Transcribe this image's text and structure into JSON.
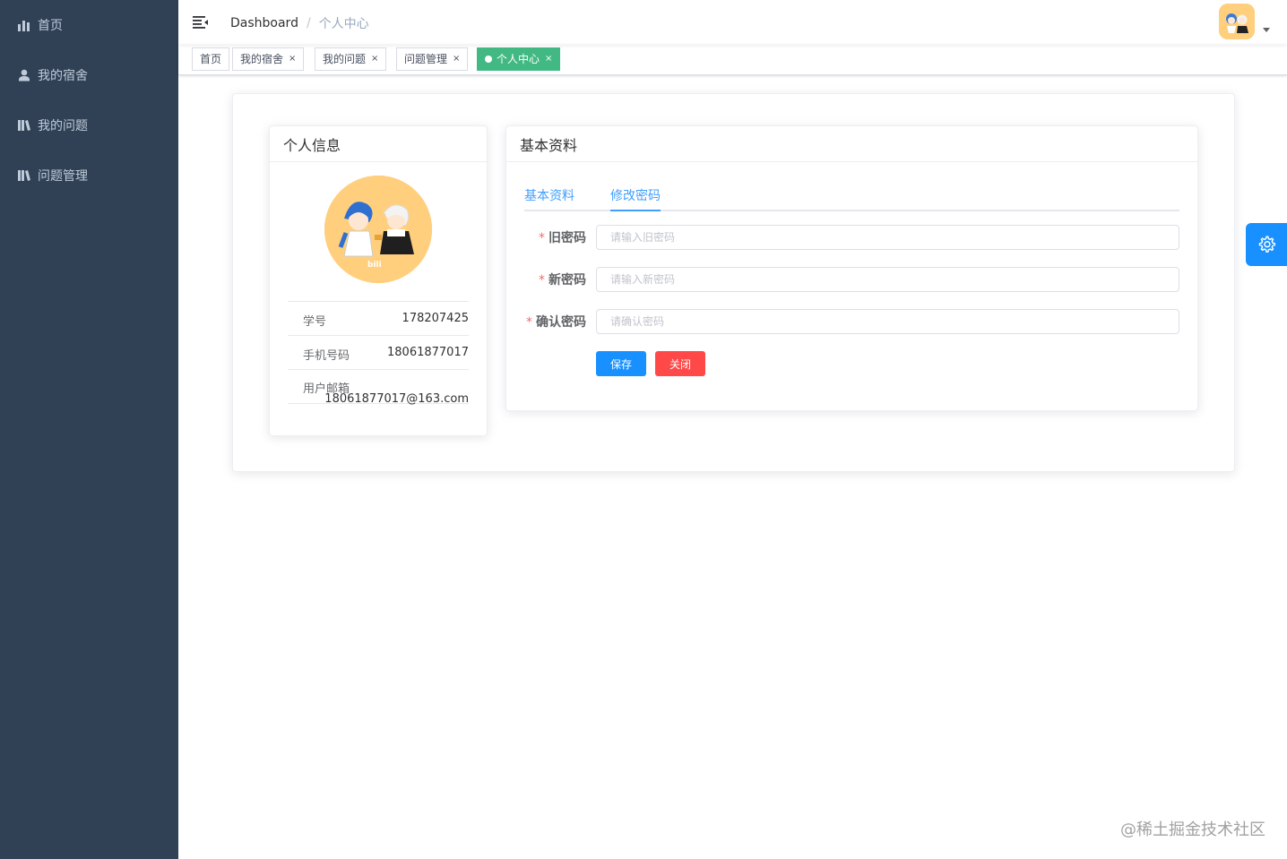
{
  "sidebar": {
    "items": [
      {
        "label": "首页",
        "icon": "chart-icon"
      },
      {
        "label": "我的宿舍",
        "icon": "user-icon"
      },
      {
        "label": "我的问题",
        "icon": "book-icon"
      },
      {
        "label": "问题管理",
        "icon": "book-icon"
      }
    ]
  },
  "navbar": {
    "breadcrumb": {
      "home": "Dashboard",
      "separator": "/",
      "current": "个人中心"
    }
  },
  "tags": [
    {
      "label": "首页",
      "closable": false
    },
    {
      "label": "我的宿舍",
      "closable": true
    },
    {
      "label": "我的问题",
      "closable": true
    },
    {
      "label": "问题管理",
      "closable": true
    },
    {
      "label": "个人中心",
      "closable": true,
      "active": true
    }
  ],
  "tag_close_glyph": "×",
  "profile": {
    "title": "个人信息",
    "student_id_label": "学号",
    "student_id": "178207425",
    "phone_label": "手机号码",
    "phone": "18061877017",
    "email_label": "用户邮箱",
    "email": "18061877017@163.com"
  },
  "basic": {
    "title": "基本资料",
    "tabs": [
      {
        "label": "基本资料",
        "active": false
      },
      {
        "label": "修改密码",
        "active": true
      }
    ],
    "form": {
      "old_password": {
        "label": "旧密码",
        "placeholder": "请输入旧密码"
      },
      "new_password": {
        "label": "新密码",
        "placeholder": "请输入新密码"
      },
      "confirm_password": {
        "label": "确认密码",
        "placeholder": "请确认密码"
      },
      "required_mark": "*",
      "save_label": "保存",
      "close_label": "关闭"
    }
  },
  "watermark": "@稀土掘金技术社区",
  "colors": {
    "sidebar_bg": "#304156",
    "primary": "#1890ff",
    "danger": "#ff4949",
    "tag_active": "#42b983",
    "tab_active": "#409eff"
  }
}
